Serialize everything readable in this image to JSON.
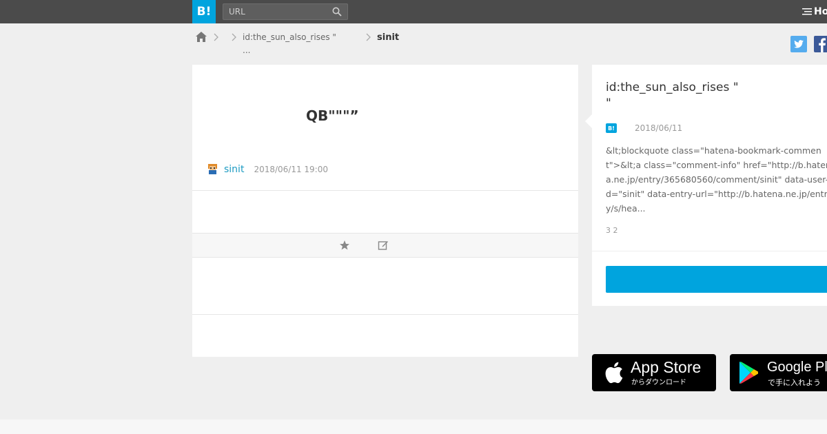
{
  "header": {
    "logo": "B!",
    "search_placeholder": "URL",
    "right_label": "Ho"
  },
  "breadcrumb": {
    "item1_line1": "id:the_sun_also_rises \"",
    "item1_line2": "...",
    "current": "sinit"
  },
  "entry": {
    "title": "QB\"\"\"”",
    "username": "sinit",
    "timestamp": "2018/06/11 19:00"
  },
  "side": {
    "title": "id:the_sun_also_rises \"\n\"",
    "badge": "B!",
    "date": "2018/06/11",
    "comment": "&lt;blockquote class=\"hatena-bookmark-comment\">&lt;a class=\"comment-info\" href=\"http://b.hatena.ne.jp/entry/365680560/comment/sinit\" data-user-id=\"sinit\" data-entry-url=\"http://b.hatena.ne.jp/entry/s/hea...",
    "counts": "3 2"
  },
  "stores": {
    "app_name": "App Store",
    "app_sub": "からダウンロード",
    "play_name": "Google Play",
    "play_sub": "で手に入れよう"
  },
  "colors": {
    "brand": "#00a4de",
    "topbar": "#4b4b4b",
    "link": "#1d9bc2"
  }
}
